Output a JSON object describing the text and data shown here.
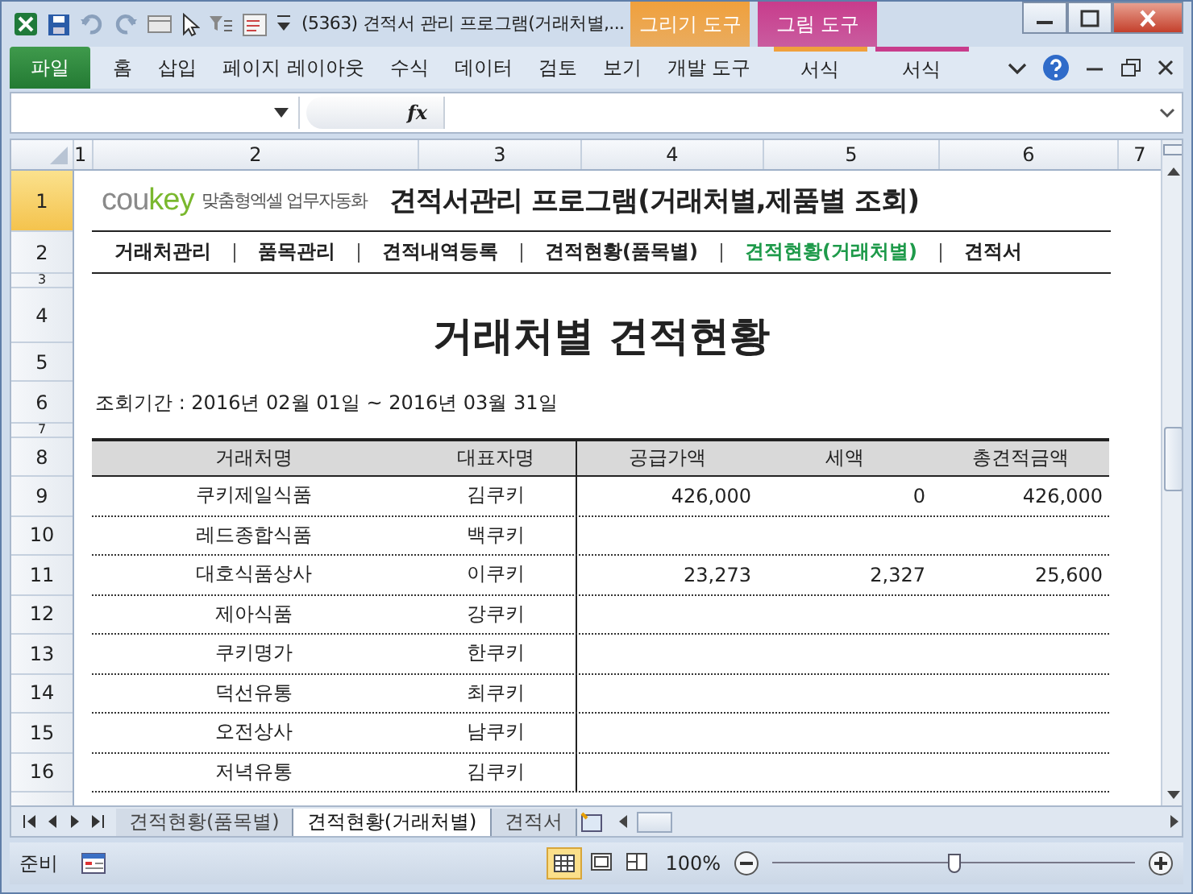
{
  "window": {
    "title": "(5363) 견적서 관리 프로그램(거래처별,..."
  },
  "context_tabs": [
    {
      "label": "그리기 도구",
      "tab": "서식",
      "color": "#f0a03c"
    },
    {
      "label": "그림 도구",
      "tab": "서식",
      "color": "#c83c8c"
    }
  ],
  "ribbon_tabs": [
    {
      "label": "파일",
      "kind": "file"
    },
    {
      "label": "홈",
      "kind": "tab"
    },
    {
      "label": "삽입",
      "kind": "tab"
    },
    {
      "label": "페이지 레이아웃",
      "kind": "tab"
    },
    {
      "label": "수식",
      "kind": "tab"
    },
    {
      "label": "데이터",
      "kind": "tab"
    },
    {
      "label": "검토",
      "kind": "tab"
    },
    {
      "label": "보기",
      "kind": "tab"
    },
    {
      "label": "개발 도구",
      "kind": "tab"
    }
  ],
  "formula_bar": {
    "function_label": "fx"
  },
  "column_headers": [
    "1",
    "2",
    "3",
    "4",
    "5",
    "6",
    "7"
  ],
  "row_headers": [
    "1",
    "2",
    "3",
    "4",
    "5",
    "6",
    "7",
    "8",
    "9",
    "10",
    "11",
    "12",
    "13",
    "14",
    "15",
    "16"
  ],
  "sheet": {
    "logo": "coukey",
    "tagline": "맞춤형엑셀 업무자동화",
    "title": "견적서관리 프로그램(거래처별,제품별 조회)",
    "nav": [
      {
        "label": "거래처관리",
        "selected": false
      },
      {
        "label": "품목관리",
        "selected": false
      },
      {
        "label": "견적내역등록",
        "selected": false
      },
      {
        "label": "견적현황(품목별)",
        "selected": false
      },
      {
        "label": "견적현황(거래처별)",
        "selected": true
      },
      {
        "label": "견적서",
        "selected": false
      }
    ],
    "report_title": "거래처별 견적현황",
    "period": "조회기간 : 2016년 02월 01일 ~ 2016년 03월 31일",
    "table": {
      "columns": [
        "거래처명",
        "대표자명",
        "공급가액",
        "세액",
        "총견적금액"
      ],
      "rows": [
        [
          "쿠키제일식품",
          "김쿠키",
          "426,000",
          "0",
          "426,000"
        ],
        [
          "레드종합식품",
          "백쿠키",
          "",
          "",
          ""
        ],
        [
          "대호식품상사",
          "이쿠키",
          "23,273",
          "2,327",
          "25,600"
        ],
        [
          "제아식품",
          "강쿠키",
          "",
          "",
          ""
        ],
        [
          "쿠키명가",
          "한쿠키",
          "",
          "",
          ""
        ],
        [
          "덕선유통",
          "최쿠키",
          "",
          "",
          ""
        ],
        [
          "오전상사",
          "남쿠키",
          "",
          "",
          ""
        ],
        [
          "저녁유통",
          "김쿠키",
          "",
          "",
          ""
        ]
      ]
    }
  },
  "sheet_tabs": [
    {
      "label": "견적현황(품목별)",
      "selected": false
    },
    {
      "label": "견적현황(거래처별)",
      "selected": true
    },
    {
      "label": "견적서",
      "selected": false
    }
  ],
  "status_bar": {
    "status": "준비",
    "views": [
      {
        "kind": "normal",
        "selected": true
      },
      {
        "kind": "layout",
        "selected": false
      },
      {
        "kind": "pagebreak",
        "selected": false
      }
    ],
    "zoom": "100%",
    "zoom_slider": {
      "level": 0.5
    }
  }
}
